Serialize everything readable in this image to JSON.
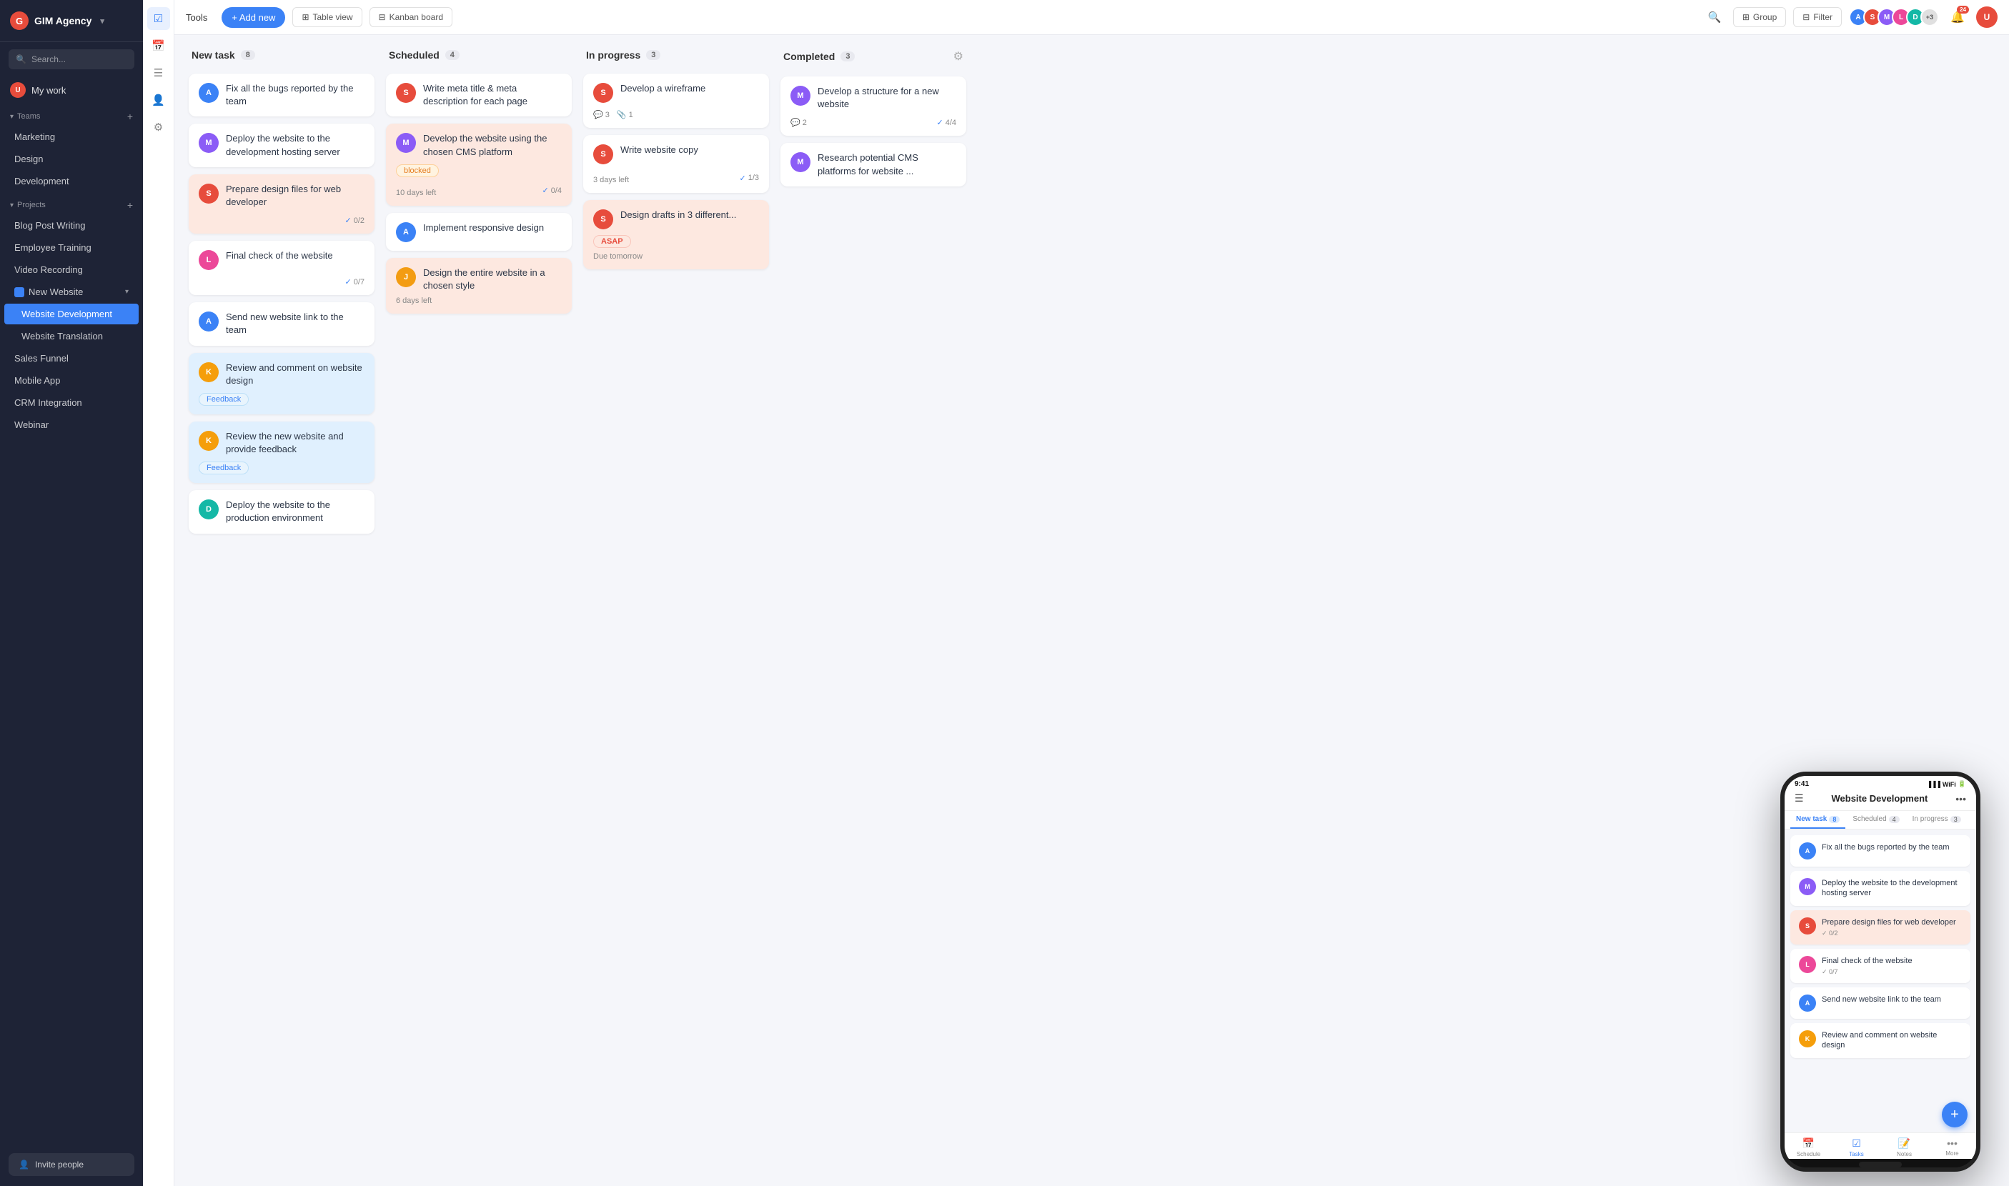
{
  "app": {
    "logo_letter": "G",
    "logo_name": "GIM Agency",
    "logo_chevron": "▾"
  },
  "sidebar": {
    "search_placeholder": "Search...",
    "my_work": "My work",
    "teams_label": "Teams",
    "teams_add": "+",
    "teams": [
      {
        "label": "Marketing"
      },
      {
        "label": "Design"
      },
      {
        "label": "Development"
      }
    ],
    "projects_label": "Projects",
    "projects_add": "+",
    "projects": [
      {
        "label": "Blog Post Writing",
        "sub": false
      },
      {
        "label": "Employee Training",
        "sub": false
      },
      {
        "label": "Video Recording",
        "sub": false
      },
      {
        "label": "New Website",
        "sub": false,
        "has_children": true,
        "expanded": true
      },
      {
        "label": "Website Development",
        "sub": true,
        "active": true
      },
      {
        "label": "Website Translation",
        "sub": true
      },
      {
        "label": "Sales Funnel",
        "sub": false
      },
      {
        "label": "Mobile App",
        "sub": false
      },
      {
        "label": "CRM Integration",
        "sub": false
      },
      {
        "label": "Webinar",
        "sub": false
      }
    ],
    "invite_label": "Invite people"
  },
  "toolbar": {
    "tools_label": "Tools",
    "add_new_label": "+ Add new",
    "table_view_label": "Table view",
    "kanban_board_label": "Kanban board",
    "group_label": "Group",
    "filter_label": "Filter",
    "avatars_extra": "+3",
    "notif_count": "24"
  },
  "columns": [
    {
      "id": "new_task",
      "title": "New task",
      "count": "8",
      "cards": [
        {
          "id": 1,
          "title": "Fix all the bugs reported by the team",
          "avatar_color": "av-blue",
          "avatar_letter": "A",
          "style": ""
        },
        {
          "id": 2,
          "title": "Deploy the website to the development hosting server",
          "avatar_color": "av-purple",
          "avatar_letter": "M",
          "style": ""
        },
        {
          "id": 3,
          "title": "Prepare design files for web developer",
          "avatar_color": "av-red",
          "avatar_letter": "S",
          "style": "salmon",
          "check": "✓ 0/2"
        },
        {
          "id": 4,
          "title": "Final check of the website",
          "avatar_color": "av-pink",
          "avatar_letter": "L",
          "style": "",
          "check": "✓ 0/7"
        },
        {
          "id": 5,
          "title": "Send new website link to the team",
          "avatar_color": "av-blue",
          "avatar_letter": "A",
          "style": ""
        },
        {
          "id": 6,
          "title": "Review and comment on website design",
          "avatar_color": "av-yellow",
          "avatar_letter": "K",
          "style": "light-blue",
          "tag": "Feedback",
          "tag_type": "feedback"
        },
        {
          "id": 7,
          "title": "Review the new website and provide feedback",
          "avatar_color": "av-yellow",
          "avatar_letter": "K",
          "style": "light-blue",
          "tag": "Feedback",
          "tag_type": "feedback"
        },
        {
          "id": 8,
          "title": "Deploy the website to the production environment",
          "avatar_color": "av-teal",
          "avatar_letter": "D",
          "style": ""
        }
      ]
    },
    {
      "id": "scheduled",
      "title": "Scheduled",
      "count": "4",
      "cards": [
        {
          "id": 9,
          "title": "Write meta title & meta description for each page",
          "avatar_color": "av-red",
          "avatar_letter": "S",
          "style": ""
        },
        {
          "id": 10,
          "title": "Develop the website using the chosen CMS platform",
          "avatar_color": "av-purple",
          "avatar_letter": "M",
          "style": "salmon",
          "tag": "blocked",
          "tag_type": "blocked",
          "days_left": "10 days left",
          "check": "✓ 0/4"
        },
        {
          "id": 11,
          "title": "Implement responsive design",
          "avatar_color": "av-blue",
          "avatar_letter": "A",
          "style": ""
        },
        {
          "id": 12,
          "title": "Design the entire website in a chosen style",
          "avatar_color": "av-orange",
          "avatar_letter": "J",
          "style": "salmon",
          "days_left": "6 days left"
        }
      ]
    },
    {
      "id": "in_progress",
      "title": "In progress",
      "count": "3",
      "cards": [
        {
          "id": 13,
          "title": "Develop a wireframe",
          "avatar_color": "av-red",
          "avatar_letter": "S",
          "style": "",
          "comments": "3",
          "attachments": "1"
        },
        {
          "id": 14,
          "title": "Write website copy",
          "avatar_color": "av-red",
          "avatar_letter": "S",
          "style": "",
          "days_left_label": "3 days left",
          "check": "✓ 1/3"
        },
        {
          "id": 15,
          "title": "Design drafts in 3 different...",
          "avatar_color": "av-red",
          "avatar_letter": "S",
          "style": "light-red",
          "tag": "ASAP",
          "tag_type": "asap",
          "days_left": "Due tomorrow"
        }
      ]
    },
    {
      "id": "completed",
      "title": "Completed",
      "count": "3",
      "cards": [
        {
          "id": 16,
          "title": "Develop a structure for a new website",
          "avatar_color": "av-purple",
          "avatar_letter": "M",
          "style": "",
          "comments": "2",
          "check_completed": "✓ 4/4"
        },
        {
          "id": 17,
          "title": "Research potential CMS platforms for website ...",
          "avatar_color": "av-purple",
          "avatar_letter": "M",
          "style": ""
        }
      ]
    }
  ],
  "phone": {
    "time": "9:41",
    "title": "Website Development",
    "tabs": [
      {
        "label": "New task",
        "count": "8"
      },
      {
        "label": "Scheduled",
        "count": "4"
      },
      {
        "label": "In progress",
        "count": "3"
      }
    ],
    "cards": [
      {
        "title": "Fix all the bugs reported by the team",
        "avatar_color": "av-blue",
        "avatar_letter": "A",
        "style": ""
      },
      {
        "title": "Deploy the website to the development hosting server",
        "avatar_color": "av-purple",
        "avatar_letter": "M",
        "style": ""
      },
      {
        "title": "Prepare design files for web developer",
        "avatar_color": "av-red",
        "avatar_letter": "S",
        "style": "salmon",
        "meta": "✓ 0/2"
      },
      {
        "title": "Final check of the website",
        "avatar_color": "av-pink",
        "avatar_letter": "L",
        "style": "",
        "meta": "✓ 0/7"
      },
      {
        "title": "Send new website link to the team",
        "avatar_color": "av-blue",
        "avatar_letter": "A",
        "style": ""
      },
      {
        "title": "Review and comment on website design",
        "avatar_color": "av-yellow",
        "avatar_letter": "K",
        "style": ""
      }
    ],
    "nav": [
      {
        "label": "Schedule",
        "icon": "📅"
      },
      {
        "label": "Tasks",
        "icon": "☑️",
        "active": true
      },
      {
        "label": "Notes",
        "icon": "📝"
      },
      {
        "label": "More",
        "icon": "•••"
      }
    ]
  }
}
